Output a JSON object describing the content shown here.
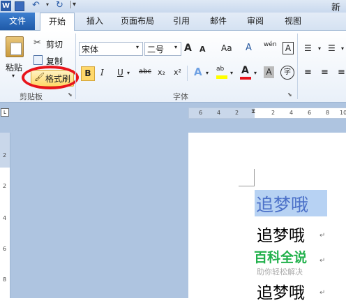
{
  "window": {
    "title_partial": "新"
  },
  "tabs": [
    {
      "label": "文件"
    },
    {
      "label": "开始"
    },
    {
      "label": "插入"
    },
    {
      "label": "页面布局"
    },
    {
      "label": "引用"
    },
    {
      "label": "邮件"
    },
    {
      "label": "审阅"
    },
    {
      "label": "视图"
    }
  ],
  "clipboard": {
    "paste_label": "粘贴",
    "cut_label": "剪切",
    "copy_label": "复制",
    "format_painter_label": "格式刷",
    "group_label": "剪贴板"
  },
  "font": {
    "font_name": "宋体",
    "font_size": "二号",
    "group_label": "字体",
    "bold": "B",
    "italic": "I",
    "underline": "U",
    "strike": "abc",
    "subscript": "x₂",
    "superscript": "x²",
    "grow": "A",
    "shrink": "A",
    "change_case": "Aa",
    "clear_format": "A",
    "phonetic": "wén",
    "char_border": "A",
    "char_shading": "A",
    "enclose": "字"
  },
  "ruler": {
    "h_ticks": [
      "6",
      "4",
      "2",
      "2",
      "4",
      "6",
      "8",
      "10"
    ],
    "v_ticks": [
      "2",
      "2",
      "4",
      "6",
      "8"
    ]
  },
  "document": {
    "line1": "追梦哦",
    "line2": "追梦哦",
    "watermark_title": "百科全说",
    "watermark_sub": "助你轻松解决",
    "line3": "追梦哦"
  },
  "colors": {
    "highlight": "#b7d2f3",
    "annotation": "#e8141b",
    "watermark": "#22b14c"
  }
}
